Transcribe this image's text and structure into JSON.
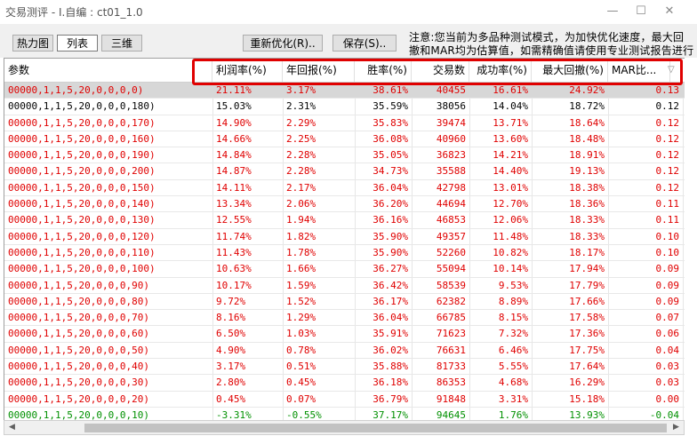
{
  "window": {
    "title": "交易测评 - I.自编 : ct01_1.0"
  },
  "toolbar": {
    "heatmap": "热力图",
    "list": "列表",
    "threed": "三维",
    "reoptimize": "重新优化(R)..",
    "save": "保存(S)..",
    "notice_line1": "注意:您当前为多品种测试模式，为加快优化速度，最大回",
    "notice_line2": "撤和MAR均为估算值，如需精确值请使用专业测试报告进行"
  },
  "table": {
    "headers": {
      "params": "参数",
      "profit": "利润率(%)",
      "annual": "年回报(%)",
      "winrate": "胜率(%)",
      "trades": "交易数",
      "success": "成功率(%)",
      "drawdown": "最大回撤(%)",
      "mar": "MAR比..."
    },
    "rows": [
      {
        "params": "00000,1,1,5,20,0,0,0,0)",
        "profit": "21.11%",
        "annual": "3.17%",
        "winrate": "38.61%",
        "trades": "40455",
        "success": "16.61%",
        "drawdown": "24.92%",
        "mar": "0.13",
        "color": "red"
      },
      {
        "params": "00000,1,1,5,20,0,0,0,180)",
        "profit": "15.03%",
        "annual": "2.31%",
        "winrate": "35.59%",
        "trades": "38056",
        "success": "14.04%",
        "drawdown": "18.72%",
        "mar": "0.12",
        "color": "black"
      },
      {
        "params": "00000,1,1,5,20,0,0,0,170)",
        "profit": "14.90%",
        "annual": "2.29%",
        "winrate": "35.83%",
        "trades": "39474",
        "success": "13.71%",
        "drawdown": "18.64%",
        "mar": "0.12",
        "color": "red"
      },
      {
        "params": "00000,1,1,5,20,0,0,0,160)",
        "profit": "14.66%",
        "annual": "2.25%",
        "winrate": "36.08%",
        "trades": "40960",
        "success": "13.60%",
        "drawdown": "18.48%",
        "mar": "0.12",
        "color": "red"
      },
      {
        "params": "00000,1,1,5,20,0,0,0,190)",
        "profit": "14.84%",
        "annual": "2.28%",
        "winrate": "35.05%",
        "trades": "36823",
        "success": "14.21%",
        "drawdown": "18.91%",
        "mar": "0.12",
        "color": "red"
      },
      {
        "params": "00000,1,1,5,20,0,0,0,200)",
        "profit": "14.87%",
        "annual": "2.28%",
        "winrate": "34.73%",
        "trades": "35588",
        "success": "14.40%",
        "drawdown": "19.13%",
        "mar": "0.12",
        "color": "red"
      },
      {
        "params": "00000,1,1,5,20,0,0,0,150)",
        "profit": "14.11%",
        "annual": "2.17%",
        "winrate": "36.04%",
        "trades": "42798",
        "success": "13.01%",
        "drawdown": "18.38%",
        "mar": "0.12",
        "color": "red"
      },
      {
        "params": "00000,1,1,5,20,0,0,0,140)",
        "profit": "13.34%",
        "annual": "2.06%",
        "winrate": "36.20%",
        "trades": "44694",
        "success": "12.70%",
        "drawdown": "18.36%",
        "mar": "0.11",
        "color": "red"
      },
      {
        "params": "00000,1,1,5,20,0,0,0,130)",
        "profit": "12.55%",
        "annual": "1.94%",
        "winrate": "36.16%",
        "trades": "46853",
        "success": "12.06%",
        "drawdown": "18.33%",
        "mar": "0.11",
        "color": "red"
      },
      {
        "params": "00000,1,1,5,20,0,0,0,120)",
        "profit": "11.74%",
        "annual": "1.82%",
        "winrate": "35.90%",
        "trades": "49357",
        "success": "11.48%",
        "drawdown": "18.33%",
        "mar": "0.10",
        "color": "red"
      },
      {
        "params": "00000,1,1,5,20,0,0,0,110)",
        "profit": "11.43%",
        "annual": "1.78%",
        "winrate": "35.90%",
        "trades": "52260",
        "success": "10.82%",
        "drawdown": "18.17%",
        "mar": "0.10",
        "color": "red"
      },
      {
        "params": "00000,1,1,5,20,0,0,0,100)",
        "profit": "10.63%",
        "annual": "1.66%",
        "winrate": "36.27%",
        "trades": "55094",
        "success": "10.14%",
        "drawdown": "17.94%",
        "mar": "0.09",
        "color": "red"
      },
      {
        "params": "00000,1,1,5,20,0,0,0,90)",
        "profit": "10.17%",
        "annual": "1.59%",
        "winrate": "36.42%",
        "trades": "58539",
        "success": "9.53%",
        "drawdown": "17.79%",
        "mar": "0.09",
        "color": "red"
      },
      {
        "params": "00000,1,1,5,20,0,0,0,80)",
        "profit": "9.72%",
        "annual": "1.52%",
        "winrate": "36.17%",
        "trades": "62382",
        "success": "8.89%",
        "drawdown": "17.66%",
        "mar": "0.09",
        "color": "red"
      },
      {
        "params": "00000,1,1,5,20,0,0,0,70)",
        "profit": "8.16%",
        "annual": "1.29%",
        "winrate": "36.04%",
        "trades": "66785",
        "success": "8.15%",
        "drawdown": "17.58%",
        "mar": "0.07",
        "color": "red"
      },
      {
        "params": "00000,1,1,5,20,0,0,0,60)",
        "profit": "6.50%",
        "annual": "1.03%",
        "winrate": "35.91%",
        "trades": "71623",
        "success": "7.32%",
        "drawdown": "17.36%",
        "mar": "0.06",
        "color": "red"
      },
      {
        "params": "00000,1,1,5,20,0,0,0,50)",
        "profit": "4.90%",
        "annual": "0.78%",
        "winrate": "36.02%",
        "trades": "76631",
        "success": "6.46%",
        "drawdown": "17.75%",
        "mar": "0.04",
        "color": "red"
      },
      {
        "params": "00000,1,1,5,20,0,0,0,40)",
        "profit": "3.17%",
        "annual": "0.51%",
        "winrate": "35.88%",
        "trades": "81733",
        "success": "5.55%",
        "drawdown": "17.64%",
        "mar": "0.03",
        "color": "red"
      },
      {
        "params": "00000,1,1,5,20,0,0,0,30)",
        "profit": "2.80%",
        "annual": "0.45%",
        "winrate": "36.18%",
        "trades": "86353",
        "success": "4.68%",
        "drawdown": "16.29%",
        "mar": "0.03",
        "color": "red"
      },
      {
        "params": "00000,1,1,5,20,0,0,0,20)",
        "profit": "0.45%",
        "annual": "0.07%",
        "winrate": "36.79%",
        "trades": "91848",
        "success": "3.31%",
        "drawdown": "15.18%",
        "mar": "0.00",
        "color": "red"
      },
      {
        "params": "00000,1,1,5,20,0,0,0,10)",
        "profit": "-3.31%",
        "annual": "-0.55%",
        "winrate": "37.17%",
        "trades": "94645",
        "success": "1.76%",
        "drawdown": "13.93%",
        "mar": "-0.04",
        "color": "green"
      }
    ]
  },
  "colors": {
    "positive": "#e00000",
    "negative": "#009000",
    "highlight_box": "#e00000"
  },
  "icons": {
    "minimize": "minimize-icon",
    "maximize": "maximize-icon",
    "close": "close-icon",
    "sort": "sort-desc-icon"
  }
}
